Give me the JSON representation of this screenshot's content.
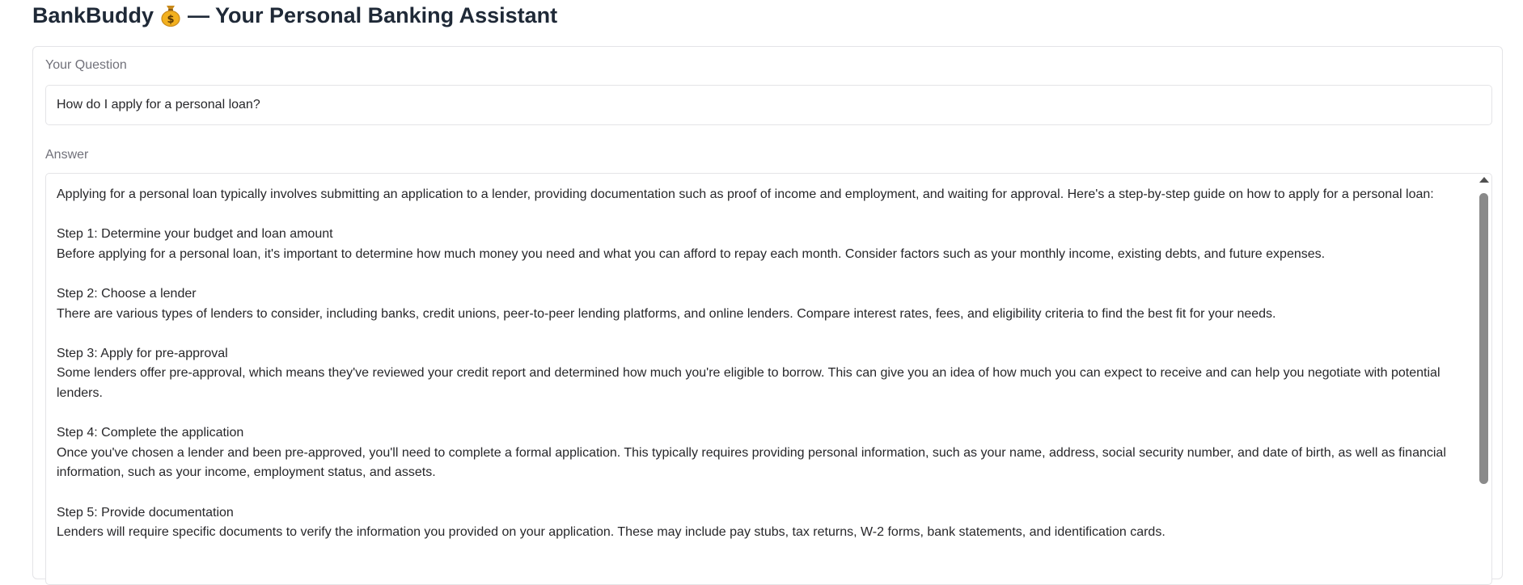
{
  "app": {
    "title_prefix": "BankBuddy",
    "title_suffix": "— Your Personal Banking Assistant",
    "icon": "money-bag-icon"
  },
  "question": {
    "label": "Your Question",
    "value": "How do I apply for a personal loan?"
  },
  "answer": {
    "label": "Answer",
    "text": "Applying for a personal loan typically involves submitting an application to a lender, providing documentation such as proof of income and employment, and waiting for approval. Here's a step-by-step guide on how to apply for a personal loan:\n\nStep 1: Determine your budget and loan amount\nBefore applying for a personal loan, it's important to determine how much money you need and what you can afford to repay each month. Consider factors such as your monthly income, existing debts, and future expenses.\n\nStep 2: Choose a lender\nThere are various types of lenders to consider, including banks, credit unions, peer-to-peer lending platforms, and online lenders. Compare interest rates, fees, and eligibility criteria to find the best fit for your needs.\n\nStep 3: Apply for pre-approval\nSome lenders offer pre-approval, which means they've reviewed your credit report and determined how much you're eligible to borrow. This can give you an idea of how much you can expect to receive and can help you negotiate with potential lenders.\n\nStep 4: Complete the application\nOnce you've chosen a lender and been pre-approved, you'll need to complete a formal application. This typically requires providing personal information, such as your name, address, social security number, and date of birth, as well as financial information, such as your income, employment status, and assets.\n\nStep 5: Provide documentation\nLenders will require specific documents to verify the information you provided on your application. These may include pay stubs, tax returns, W-2 forms, bank statements, and identification cards."
  },
  "colors": {
    "border": "#e4e4e7",
    "label": "#71717a",
    "text": "#27272a",
    "scroll_thumb": "#8a8a8a"
  }
}
